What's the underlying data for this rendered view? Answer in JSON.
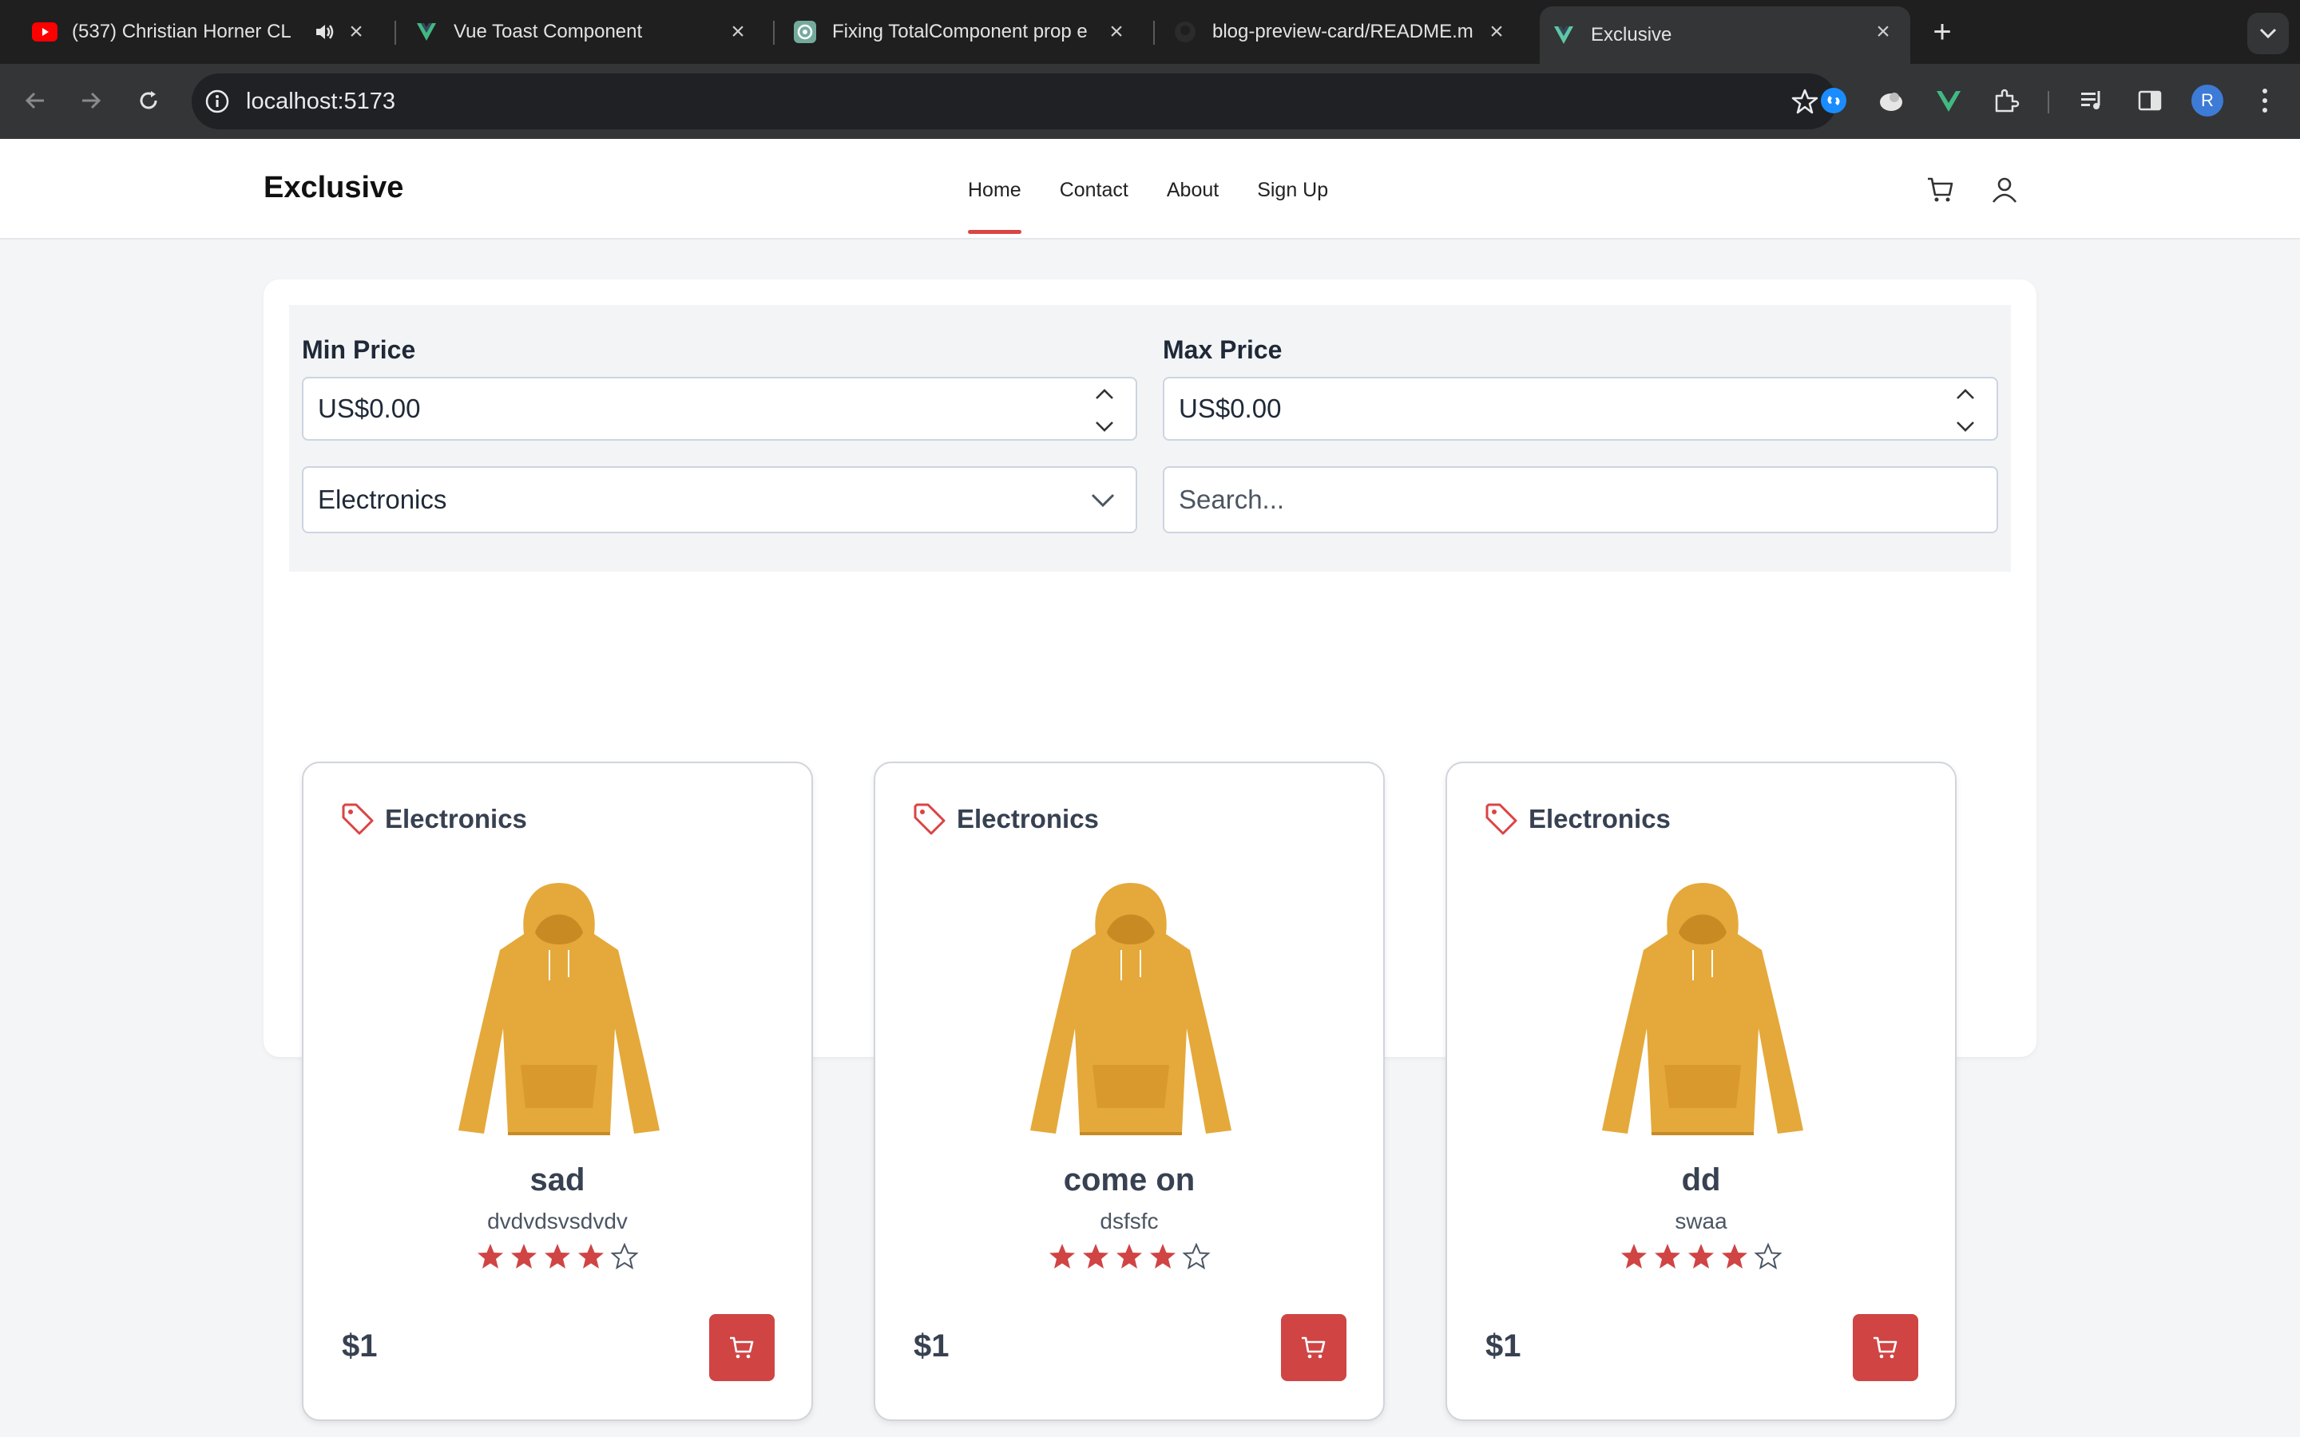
{
  "browser": {
    "tabs": [
      {
        "title": "(537) Christian Horner CL",
        "icon": "youtube-icon",
        "muted_icon": "speaker-icon"
      },
      {
        "title": "Vue Toast Component",
        "icon": "vue-icon"
      },
      {
        "title": "Fixing TotalComponent prop e",
        "icon": "chatgpt-icon"
      },
      {
        "title": "blog-preview-card/README.m",
        "icon": "github-icon"
      },
      {
        "title": "Exclusive",
        "icon": "vite-icon"
      }
    ],
    "url": "localhost:5173",
    "profile_initial": "R"
  },
  "site": {
    "brand": "Exclusive",
    "nav": [
      "Home",
      "Contact",
      "About",
      "Sign Up"
    ],
    "accent": "#DB4444"
  },
  "filters": {
    "min_label": "Min Price",
    "min_value": "US$0.00",
    "max_label": "Max Price",
    "max_value": "US$0.00",
    "category_selected": "Electronics",
    "search_placeholder": "Search..."
  },
  "products": [
    {
      "category": "Electronics",
      "name": "sad",
      "description": "dvdvdsvsdvdv",
      "rating": 4,
      "rating_max": 5,
      "price": "$1"
    },
    {
      "category": "Electronics",
      "name": "come on",
      "description": "dsfsfc",
      "rating": 4,
      "rating_max": 5,
      "price": "$1"
    },
    {
      "category": "Electronics",
      "name": "dd",
      "description": "swaa",
      "rating": 4,
      "rating_max": 5,
      "price": "$1"
    }
  ]
}
